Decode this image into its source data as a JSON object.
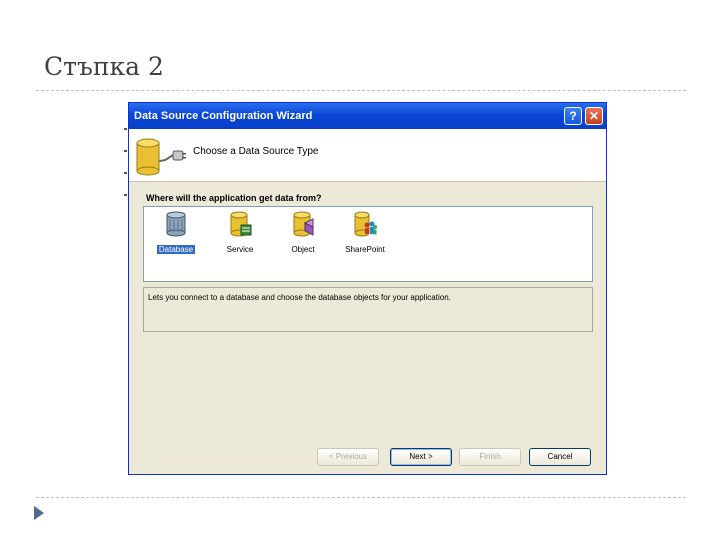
{
  "slide": {
    "title": "Стъпка 2"
  },
  "window": {
    "title": "Data Source Configuration Wizard",
    "help_label": "?",
    "close_label": "✕",
    "header_text": "Choose a Data Source Type",
    "question": "Where will the application get data from?",
    "types": [
      {
        "label": "Database",
        "icon": "database-icon",
        "selected": true
      },
      {
        "label": "Service",
        "icon": "service-icon",
        "selected": false
      },
      {
        "label": "Object",
        "icon": "object-icon",
        "selected": false
      },
      {
        "label": "SharePoint",
        "icon": "sharepoint-icon",
        "selected": false
      }
    ],
    "description": "Lets you connect to a database and choose the database objects for your application.",
    "buttons": {
      "previous": "< Previous",
      "next": "Next >",
      "finish": "Finish",
      "cancel": "Cancel"
    }
  },
  "colors": {
    "titlebar": "#0a46d6",
    "selection": "#316ac5",
    "dialog_bg": "#ece9d8",
    "db_yellow": "#e8c032"
  }
}
